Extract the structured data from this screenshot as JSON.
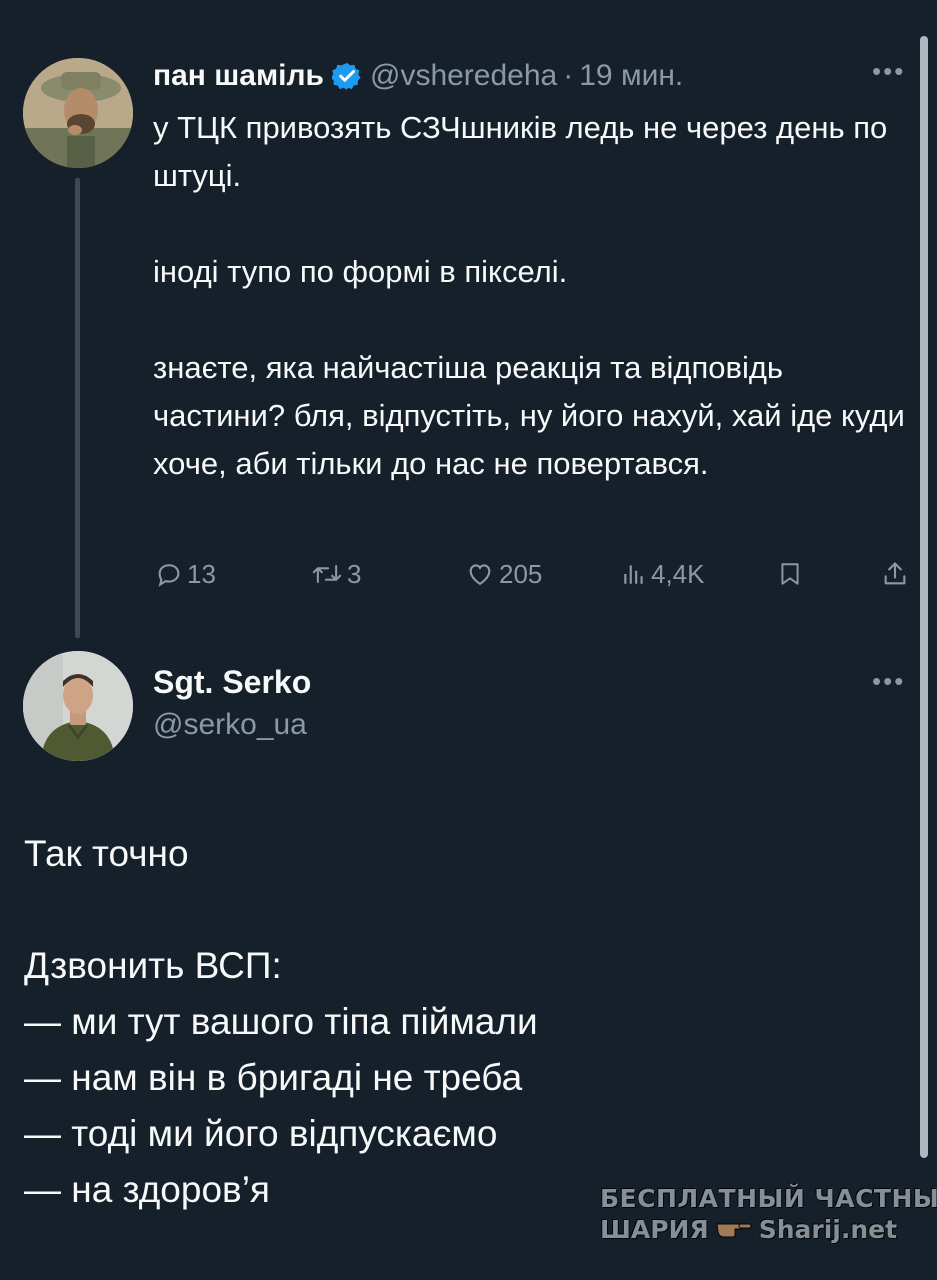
{
  "tweet": {
    "author_name": "пан шаміль",
    "handle": "@vsheredeha",
    "separator": "·",
    "time": "19 мин.",
    "more": "•••",
    "paragraphs": [
      "у ТЦК привозять СЗЧшників ледь не через день по штуці.",
      "іноді тупо по формі в пікселі.",
      "знаєте, яка найчастіша реакція та відповідь частини? бля, відпустіть, ну його нахуй, хай іде куди хоче, аби тільки до нас не повертався."
    ],
    "actions": {
      "replies": "13",
      "retweets": "3",
      "likes": "205",
      "views": "4,4K"
    }
  },
  "reply": {
    "author_name": "Sgt. Serko",
    "handle": "@serko_ua",
    "more": "•••",
    "lines": [
      "Так точно",
      "",
      "Дзвонить ВСП:",
      "— ми тут вашого тіпа піймали",
      "— нам він в бригаді не треба",
      "— тоді ми його відпускаємо",
      "— на здоров’я"
    ]
  },
  "watermark": {
    "line1": "БЕСПЛАТНЫЙ ЧАСТНЫЙ",
    "line2_left": "ШАРИЯ",
    "line2_right": "Sharij.net"
  },
  "colors": {
    "background": "#15202b",
    "text": "#f7f9f9",
    "muted": "#8b98a5",
    "verified": "#1d9bf0"
  }
}
